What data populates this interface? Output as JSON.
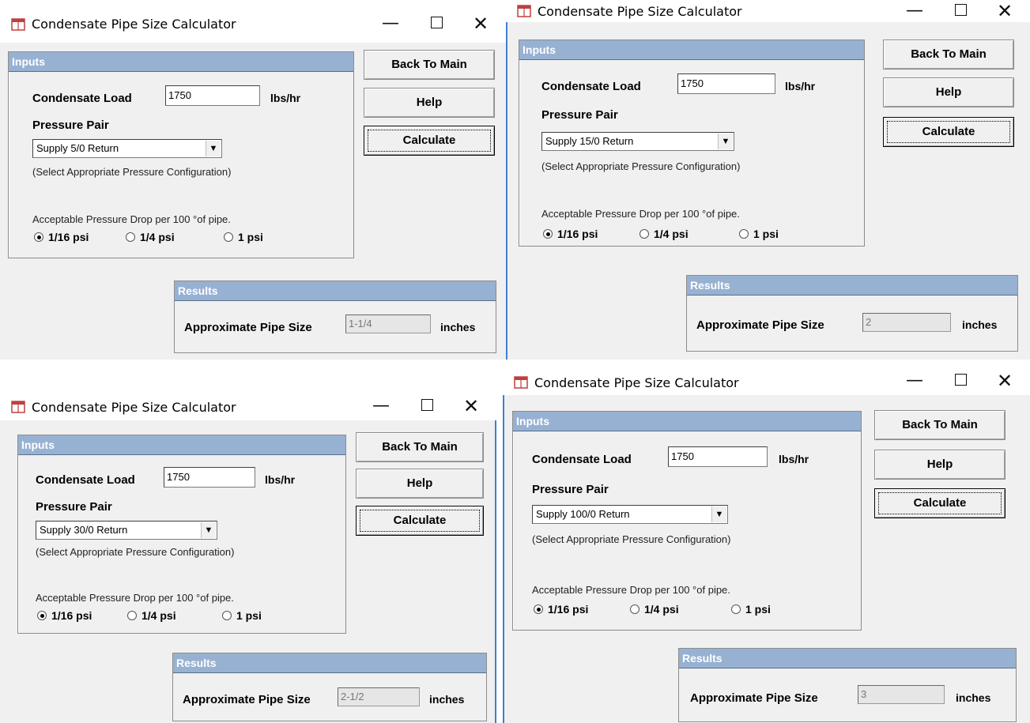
{
  "common": {
    "window_title": "Condensate Pipe Size Calculator",
    "inputs_header": "Inputs",
    "condensate_load_label": "Condensate Load",
    "condensate_load_unit": "lbs/hr",
    "pressure_pair_label": "Pressure Pair",
    "pressure_hint": "(Select Appropriate Pressure Configuration)",
    "drop_label": "Acceptable Pressure Drop per 100 °of pipe.",
    "radio_1_16": "1/16 psi",
    "radio_1_4": "1/4 psi",
    "radio_1": "1 psi",
    "back_button": "Back To Main",
    "help_button": "Help",
    "calculate_button": "Calculate",
    "results_header": "Results",
    "pipe_size_label": "Approximate Pipe Size",
    "pipe_size_unit": "inches",
    "minimize_glyph": "—",
    "close_glyph": "✕",
    "dropdown_glyph": "▼"
  },
  "windows": [
    {
      "condensate_load": "1750",
      "pressure_pair": "Supply 5/0 Return",
      "selected_drop": "1/16 psi",
      "pipe_size": "1-1/4"
    },
    {
      "condensate_load": "1750",
      "pressure_pair": "Supply 15/0 Return",
      "selected_drop": "1/16 psi",
      "pipe_size": "2"
    },
    {
      "condensate_load": "1750",
      "pressure_pair": "Supply 30/0 Return",
      "selected_drop": "1/16 psi",
      "pipe_size": "2-1/2"
    },
    {
      "condensate_load": "1750",
      "pressure_pair": "Supply 100/0 Return",
      "selected_drop": "1/16 psi",
      "pipe_size": "3"
    }
  ],
  "colors": {
    "panel_header": "#97b1d2",
    "window_bg": "#f0f0f0",
    "accent_border": "#3f7fd0"
  },
  "icons": {
    "app": "calculator-window-icon",
    "minimize": "minimize-icon",
    "maximize": "maximize-icon",
    "close": "close-icon",
    "dropdown": "chevron-down-icon"
  }
}
